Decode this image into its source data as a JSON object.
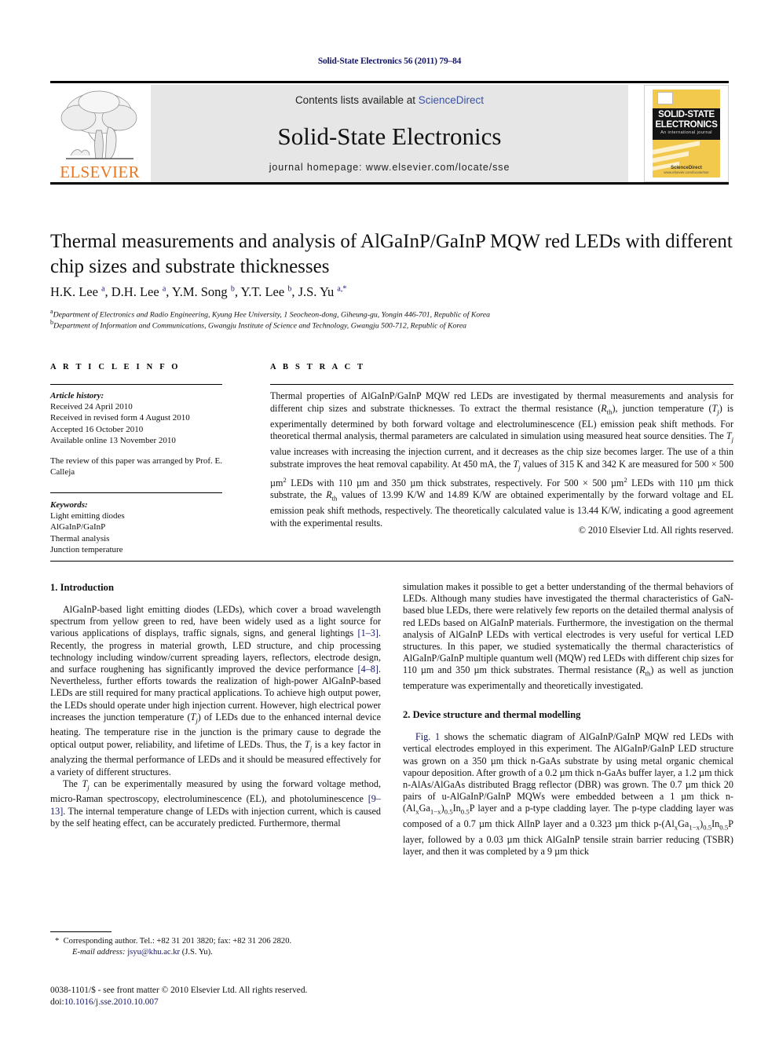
{
  "running_head": "Solid-State Electronics 56 (2011) 79–84",
  "masthead": {
    "publisher_name": "ELSEVIER",
    "contents_prefix": "Contents lists available at ",
    "contents_link": "ScienceDirect",
    "journal_name": "Solid-State Electronics",
    "journal_homepage": "journal homepage: www.elsevier.com/locate/sse",
    "cover": {
      "line1": "SOLID-STATE",
      "line2": "ELECTRONICS",
      "line3": "An international journal",
      "footer_brand": "ScienceDirect",
      "footer_sub": "www.elsevier.com/locate/sse"
    }
  },
  "article": {
    "title": "Thermal measurements and analysis of AlGaInP/GaInP MQW red LEDs with different chip sizes and substrate thicknesses",
    "authors_html": "H.K. Lee <sup>a</sup>, D.H. Lee <sup>a</sup>, Y.M. Song <sup>b</sup>, Y.T. Lee <sup>b</sup>, J.S. Yu <sup>a,*</sup>",
    "affiliation_a": "Department of Electronics and Radio Engineering, Kyung Hee University, 1 Seocheon-dong, Giheung-gu, Yongin 446-701, Republic of Korea",
    "affiliation_b": "Department of Information and Communications, Gwangju Institute of Science and Technology, Gwangju 500-712, Republic of Korea",
    "affiliation_a_marker": "a",
    "affiliation_b_marker": "b"
  },
  "info": {
    "heading": "A R T I C L E    I N F O",
    "history_label": "Article history:",
    "history": [
      "Received 24 April 2010",
      "Received in revised form 4 August 2010",
      "Accepted 16 October 2010",
      "Available online 13 November 2010"
    ],
    "editor_note": "The review of this paper was arranged by Prof. E. Calleja",
    "keywords_label": "Keywords:",
    "keywords": [
      "Light emitting diodes",
      "AlGaInP/GaInP",
      "Thermal analysis",
      "Junction temperature"
    ]
  },
  "abstract": {
    "heading": "A B S T R A C T",
    "body_html": "Thermal properties of AlGaInP/GaInP MQW red LEDs are investigated by thermal measurements and analysis for different chip sizes and substrate thicknesses. To extract the thermal resistance (<em>R</em><sub>th</sub>), junction temperature (<em>T<sub>j</sub></em>) is experimentally determined by both forward voltage and electroluminescence (EL) emission peak shift methods. For theoretical thermal analysis, thermal parameters are calculated in simulation using measured heat source densities. The <em>T<sub>j</sub></em> value increases with increasing the injection current, and it decreases as the chip size becomes larger. The use of a thin substrate improves the heat removal capability. At 450 mA, the <em>T<sub>j</sub></em> values of 315 K and 342 K are measured for 500 &times; 500 &micro;m<sup>2</sup> LEDs with 110 &micro;m and 350 &micro;m thick substrates, respectively. For 500 &times; 500 &micro;m<sup>2</sup> LEDs with 110 &micro;m thick substrate, the <em>R</em><sub>th</sub> values of 13.99 K/W and 14.89 K/W are obtained experimentally by the forward voltage and EL emission peak shift methods, respectively. The theoretically calculated value is 13.44 K/W, indicating a good agreement with the experimental results.",
    "copyright": "© 2010 Elsevier Ltd. All rights reserved."
  },
  "body": {
    "section1_heading": "1. Introduction",
    "section1_p1_html": "AlGaInP-based light emitting diodes (LEDs), which cover a broad wavelength spectrum from yellow green to red, have been widely used as a light source for various applications of displays, traffic signals, signs, and general lightings <span class=\"ref\">[1–3]</span>. Recently, the progress in material growth, LED structure, and chip processing technology including window/current spreading layers, reflectors, electrode design, and surface roughening has significantly improved the device performance <span class=\"ref\">[4–8]</span>. Nevertheless, further efforts towards the realization of high-power AlGaInP-based LEDs are still required for many practical applications. To achieve high output power, the LEDs should operate under high injection current. However, high electrical power increases the junction temperature (<em>T<sub>j</sub></em>) of LEDs due to the enhanced internal device heating. The temperature rise in the junction is the primary cause to degrade the optical output power, reliability, and lifetime of LEDs. Thus, the <em>T<sub>j</sub></em> is a key factor in analyzing the thermal performance of LEDs and it should be measured effectively for a variety of different structures.",
    "section1_p2_html": "The <em>T<sub>j</sub></em> can be experimentally measured by using the forward voltage method, micro-Raman spectroscopy, electroluminescence (EL), and photoluminescence <span class=\"ref\">[9–13]</span>. The internal temperature change of LEDs with injection current, which is caused by the self heating effect, can be accurately predicted. Furthermore, thermal",
    "section1_p2_cont_html": "simulation makes it possible to get a better understanding of the thermal behaviors of LEDs. Although many studies have investigated the thermal characteristics of GaN-based blue LEDs, there were relatively few reports on the detailed thermal analysis of red LEDs based on AlGaInP materials. Furthermore, the investigation on the thermal analysis of AlGaInP LEDs with vertical electrodes is very useful for vertical LED structures. In this paper, we studied systematically the thermal characteristics of AlGaInP/GaInP multiple quantum well (MQW) red LEDs with different chip sizes for 110 &micro;m and 350 &micro;m thick substrates. Thermal resistance (<em>R</em><sub>th</sub>) as well as junction temperature was experimentally and theoretically investigated.",
    "section2_heading": "2. Device structure and thermal modelling",
    "section2_p1_html": "<span class=\"ref\">Fig. 1</span> shows the schematic diagram of AlGaInP/GaInP MQW red LEDs with vertical electrodes employed in this experiment. The AlGaInP/GaInP LED structure was grown on a 350 &micro;m thick n-GaAs substrate by using metal organic chemical vapour deposition. After growth of a 0.2 &micro;m thick n-GaAs buffer layer, a 1.2 &micro;m thick n-AlAs/AlGaAs distributed Bragg reflector (DBR) was grown. The 0.7 &micro;m thick 20 pairs of u-AlGaInP/GaInP MQWs were embedded between a 1 &micro;m thick n-(Al<sub>x</sub>Ga<sub>1−x</sub>)<sub>0.5</sub>In<sub>0.5</sub>P layer and a p-type cladding layer. The p-type cladding layer was composed of a 0.7 &micro;m thick AlInP layer and a 0.323 &micro;m thick p-(Al<sub>x</sub>Ga<sub>1−x</sub>)<sub>0.5</sub>In<sub>0.5</sub>P layer, followed by a 0.03 &micro;m thick AlGaInP tensile strain barrier reducing (TSBR) layer, and then it was completed by a 9 &micro;m thick"
  },
  "footnotes": {
    "corresponding_marker": "*",
    "corresponding_text": "Corresponding author. Tel.: +82 31 201 3820; fax: +82 31 206 2820.",
    "email_label": "E-mail address:",
    "email": "jsyu@khu.ac.kr",
    "email_owner": "(J.S. Yu).",
    "issn_line": "0038-1101/$ - see front matter © 2010 Elsevier Ltd. All rights reserved.",
    "doi_label": "doi:",
    "doi_value": "10.1016/j.sse.2010.10.007"
  },
  "colors": {
    "link_blue": "#3b52a4",
    "ref_blue": "#16186b",
    "elsevier_orange": "#e87722",
    "masthead_gray": "#e6e6e6",
    "cover_yellow": "#f2c94c"
  }
}
